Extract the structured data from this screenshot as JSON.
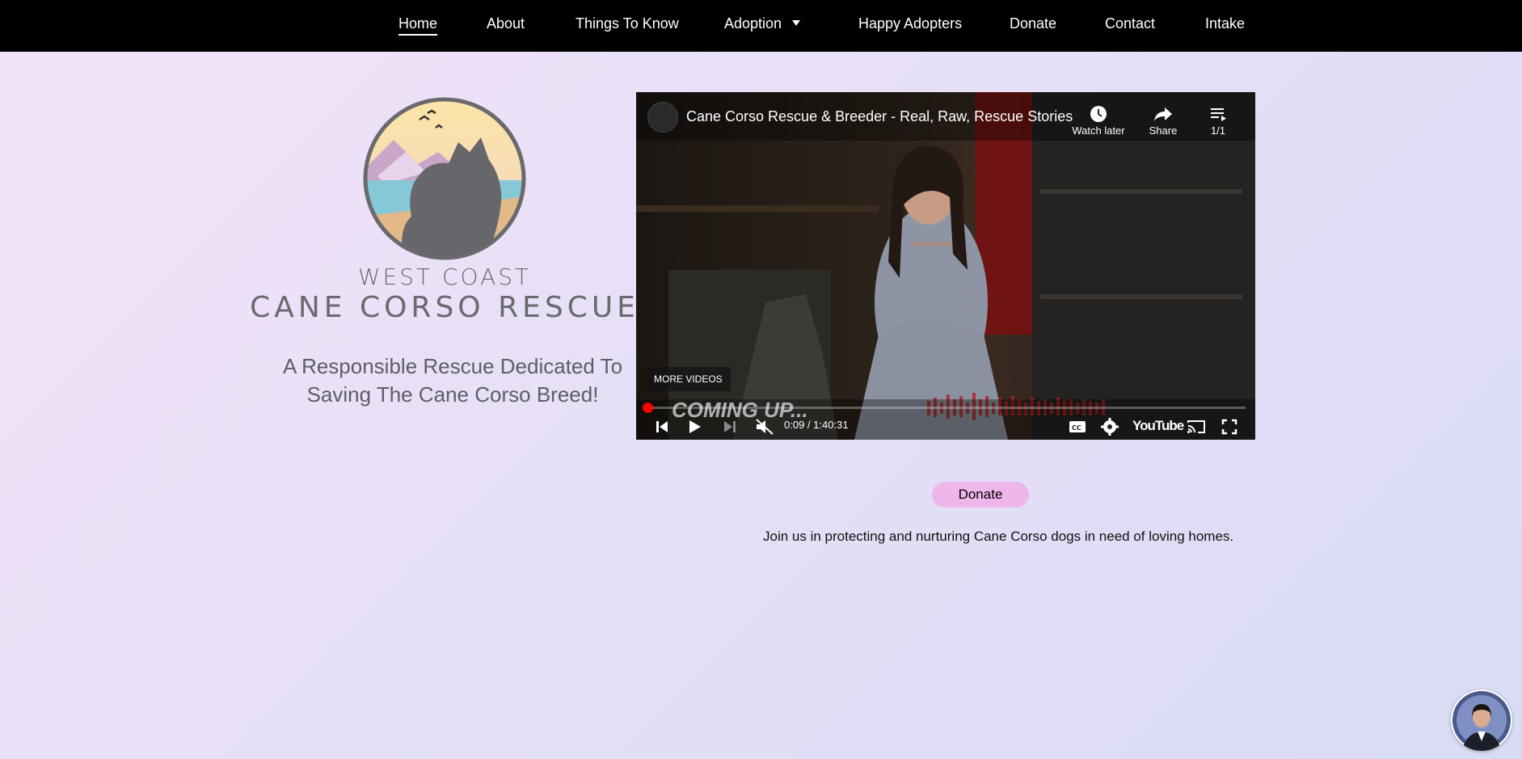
{
  "nav": {
    "items": [
      {
        "label": "Home",
        "active": true
      },
      {
        "label": "About"
      },
      {
        "label": "Things To Know"
      },
      {
        "label": "Adoption",
        "dropdown": true
      },
      {
        "label": "Happy Adopters"
      },
      {
        "label": "Donate"
      },
      {
        "label": "Contact"
      },
      {
        "label": "Intake"
      }
    ]
  },
  "logo": {
    "line1": "WEST COAST",
    "line2": "CANE CORSO RESCUE"
  },
  "tagline": {
    "line1": "A Responsible Rescue Dedicated To",
    "line2": "Saving The Cane Corso Breed!"
  },
  "video": {
    "title": "Cane Corso Rescue & Breeder - Real, Raw, Rescue Stories",
    "watch_later": "Watch later",
    "share": "Share",
    "playlist_count": "1/1",
    "more_videos": "MORE VIDEOS",
    "overlay_text": "COMING UP...",
    "time": "0:09 / 1:40:31",
    "progress": 0.0015,
    "youtube_label": "YouTube"
  },
  "donate": {
    "button_label": "Donate",
    "text": "Join us in protecting and nurturing Cane Corso dogs in need of loving homes."
  },
  "chat": {
    "icon": "chat-agent-avatar-icon"
  },
  "colors": {
    "nav_bg": "#000000",
    "donate_button": "#efb6ea",
    "logo_gray": "#6a6a6c",
    "progress_red": "#ff0000"
  }
}
